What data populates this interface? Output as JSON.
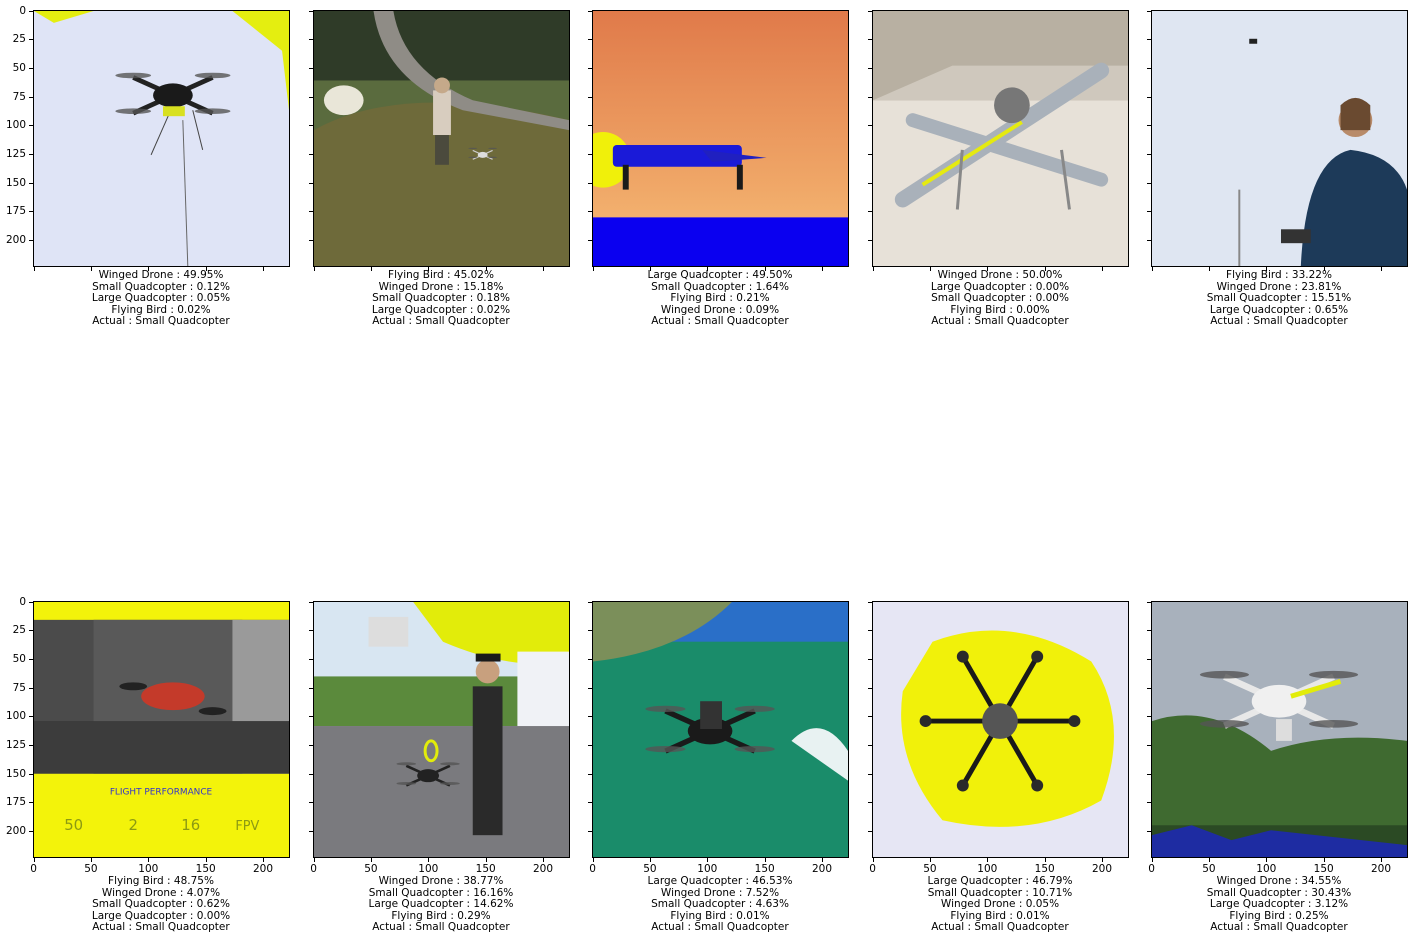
{
  "y_ticks": [
    "0",
    "25",
    "50",
    "75",
    "100",
    "125",
    "150",
    "175",
    "200"
  ],
  "x_ticks": [
    "0",
    "50",
    "100",
    "150",
    "200"
  ],
  "panels": [
    {
      "scene": "drone-tether",
      "show_y": true,
      "show_x": false,
      "lines": [
        "Winged Drone : 49.95%",
        "Small Quadcopter : 0.12%",
        "Large Quadcopter : 0.05%",
        "Flying Bird : 0.02%",
        "Actual : Small Quadcopter"
      ]
    },
    {
      "scene": "park-man",
      "show_y": false,
      "show_x": false,
      "lines": [
        "Flying Bird : 45.02%",
        "Winged Drone : 15.18%",
        "Small Quadcopter : 0.18%",
        "Large Quadcopter : 0.02%",
        "Actual : Small Quadcopter"
      ]
    },
    {
      "scene": "sunset",
      "show_y": false,
      "show_x": false,
      "lines": [
        "Large Quadcopter : 49.50%",
        "Small Quadcopter : 1.64%",
        "Flying Bird : 0.21%",
        "Winged Drone : 0.09%",
        "Actual : Small Quadcopter"
      ]
    },
    {
      "scene": "xwing",
      "show_y": false,
      "show_x": false,
      "lines": [
        "Winged Drone : 50.00%",
        "Large Quadcopter : 0.00%",
        "Small Quadcopter : 0.00%",
        "Flying Bird : 0.00%",
        "Actual : Small Quadcopter"
      ]
    },
    {
      "scene": "man-sky",
      "show_y": false,
      "show_x": false,
      "lines": [
        "Flying Bird : 33.22%",
        "Winged Drone : 23.81%",
        "Small Quadcopter : 15.51%",
        "Large Quadcopter : 0.65%",
        "Actual : Small Quadcopter"
      ]
    },
    {
      "scene": "red-drone",
      "show_y": true,
      "show_x": true,
      "lines": [
        "Flying Bird : 48.75%",
        "Winged Drone : 4.07%",
        "Small Quadcopter : 0.62%",
        "Large Quadcopter : 0.00%",
        "Actual : Small Quadcopter"
      ]
    },
    {
      "scene": "police",
      "show_y": false,
      "show_x": true,
      "lines": [
        "Winged Drone : 38.77%",
        "Small Quadcopter : 16.16%",
        "Large Quadcopter : 14.62%",
        "Flying Bird : 0.29%",
        "Actual : Small Quadcopter"
      ]
    },
    {
      "scene": "beach",
      "show_y": false,
      "show_x": true,
      "lines": [
        "Large Quadcopter : 46.53%",
        "Winged Drone : 7.52%",
        "Small Quadcopter : 4.63%",
        "Flying Bird : 0.01%",
        "Actual : Small Quadcopter"
      ]
    },
    {
      "scene": "hexa",
      "show_y": false,
      "show_x": true,
      "lines": [
        "Large Quadcopter : 46.79%",
        "Small Quadcopter : 10.71%",
        "Winged Drone : 0.05%",
        "Flying Bird : 0.01%",
        "Actual : Small Quadcopter"
      ]
    },
    {
      "scene": "white-drone",
      "show_y": false,
      "show_x": true,
      "lines": [
        "Winged Drone : 34.55%",
        "Small Quadcopter : 30.43%",
        "Large Quadcopter : 3.12%",
        "Flying Bird : 0.25%",
        "Actual : Small Quadcopter"
      ]
    }
  ],
  "flight_overlay": {
    "heading": "FLIGHT PERFORMANCE",
    "stats": [
      "50",
      "2",
      "16",
      "FPV"
    ]
  }
}
